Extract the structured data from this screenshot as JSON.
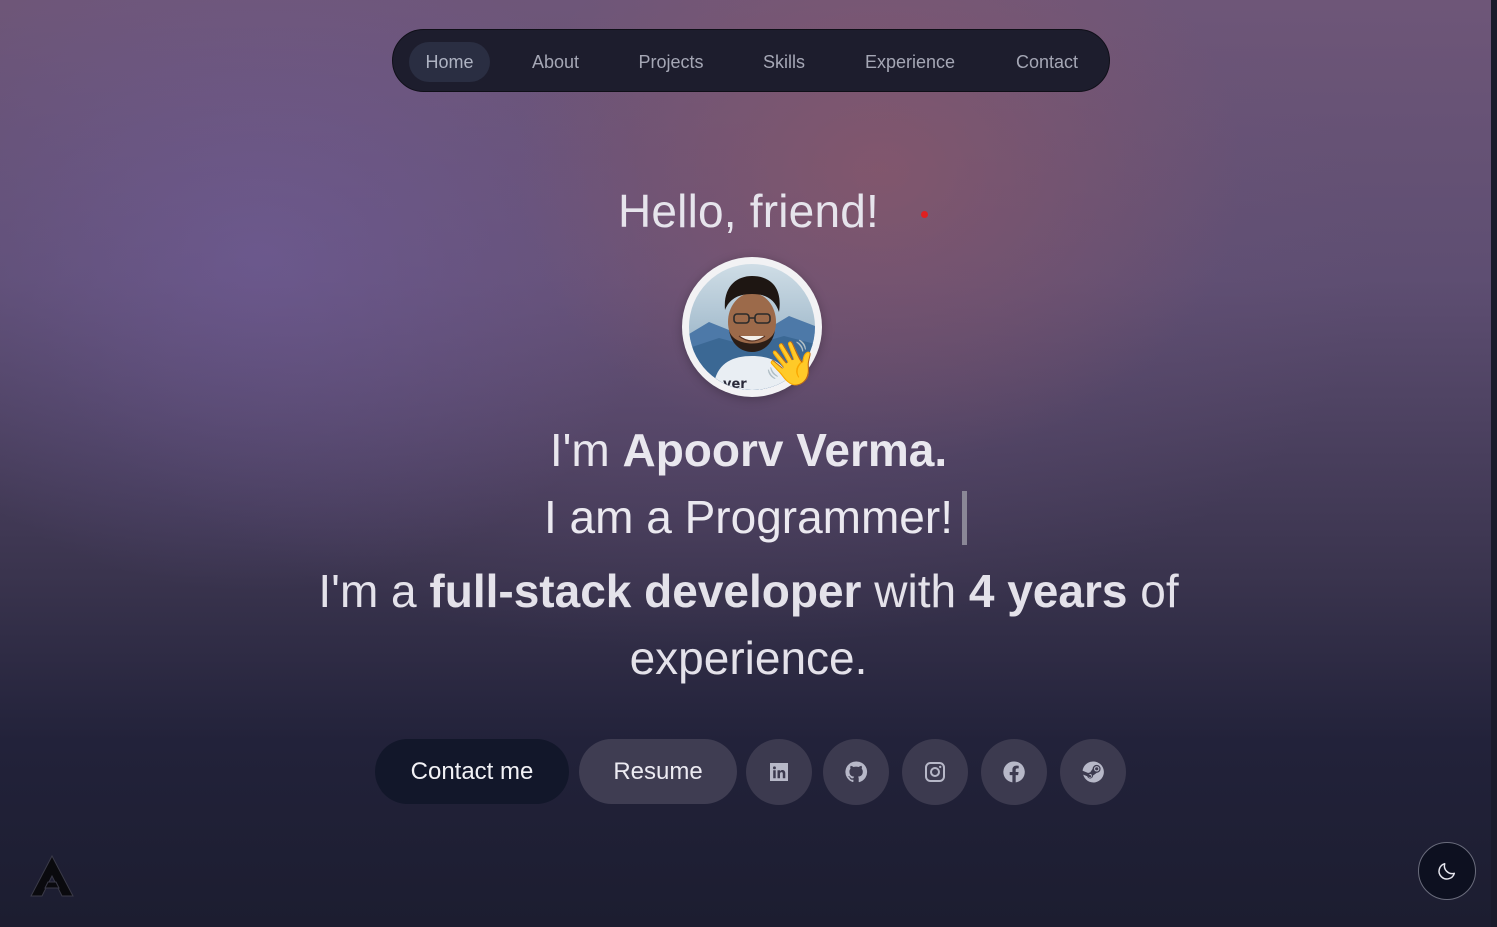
{
  "nav": {
    "items": [
      {
        "label": "Home",
        "active": true
      },
      {
        "label": "About",
        "active": false
      },
      {
        "label": "Projects",
        "active": false
      },
      {
        "label": "Skills",
        "active": false
      },
      {
        "label": "Experience",
        "active": false
      },
      {
        "label": "Contact",
        "active": false
      }
    ]
  },
  "hero": {
    "greeting": "Hello, friend!",
    "wave_emoji": "👋",
    "intro_prefix": "I'm ",
    "name": "Apoorv Verma.",
    "typed_text": "I am a Programmer!",
    "desc_1": "I'm a ",
    "desc_bold_1": "full-stack developer",
    "desc_2": " with ",
    "desc_bold_2": "4 years",
    "desc_3": " of experience."
  },
  "actions": {
    "contact_label": "Contact me",
    "resume_label": "Resume"
  },
  "social": [
    {
      "name": "linkedin-icon"
    },
    {
      "name": "github-icon"
    },
    {
      "name": "instagram-icon"
    },
    {
      "name": "facebook-icon"
    },
    {
      "name": "steam-icon"
    }
  ],
  "colors": {
    "accent_red_dot": "#e02020",
    "nav_bg": "#1d1d2d",
    "contact_button_bg": "#12172a",
    "resume_button_bg": "#3f3d52"
  }
}
